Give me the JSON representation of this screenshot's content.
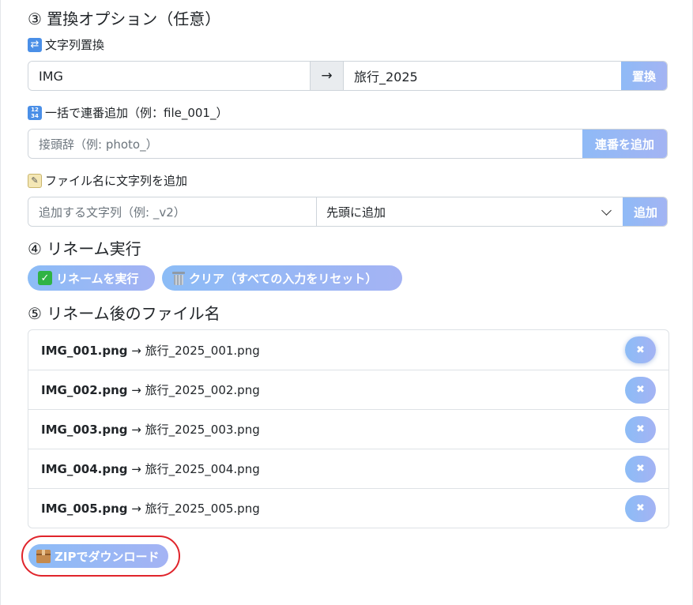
{
  "section3": {
    "title": "③ 置換オプション（任意）",
    "replace": {
      "label": "文字列置換",
      "from_value": "IMG",
      "arrow": "→",
      "to_value": "旅行_2025",
      "button": "置換"
    },
    "serial": {
      "label": "一括で連番追加（例：file_001_）",
      "placeholder": "接頭辞（例: photo_）",
      "button": "連番を追加"
    },
    "append": {
      "label": "ファイル名に文字列を追加",
      "placeholder": "追加する文字列（例: _v2）",
      "position_selected": "先頭に追加",
      "button": "追加"
    }
  },
  "section4": {
    "title": "④ リネーム実行",
    "execute_button": "リネームを実行",
    "clear_button": "クリア（すべての入力をリセット）"
  },
  "section5": {
    "title": "⑤ リネーム後のファイル名",
    "items": [
      {
        "original": "IMG_001.png",
        "renamed": "→ 旅行_2025_001.png"
      },
      {
        "original": "IMG_002.png",
        "renamed": "→ 旅行_2025_002.png"
      },
      {
        "original": "IMG_003.png",
        "renamed": "→ 旅行_2025_003.png"
      },
      {
        "original": "IMG_004.png",
        "renamed": "→ 旅行_2025_004.png"
      },
      {
        "original": "IMG_005.png",
        "renamed": "→ 旅行_2025_005.png"
      }
    ],
    "remove_symbol": "✖"
  },
  "download": {
    "button": "ZIPでダウンロード"
  },
  "icons": {
    "replace": "repeat-arrows-icon",
    "serial": "input-numbers-icon",
    "append": "memo-icon",
    "execute": "check-mark-icon",
    "clear": "wastebasket-icon",
    "download": "package-icon"
  },
  "colors": {
    "button_gradient_start": "#8cbcf6",
    "button_gradient_end": "#a4b3f4",
    "highlight_ring": "#e0242b"
  }
}
